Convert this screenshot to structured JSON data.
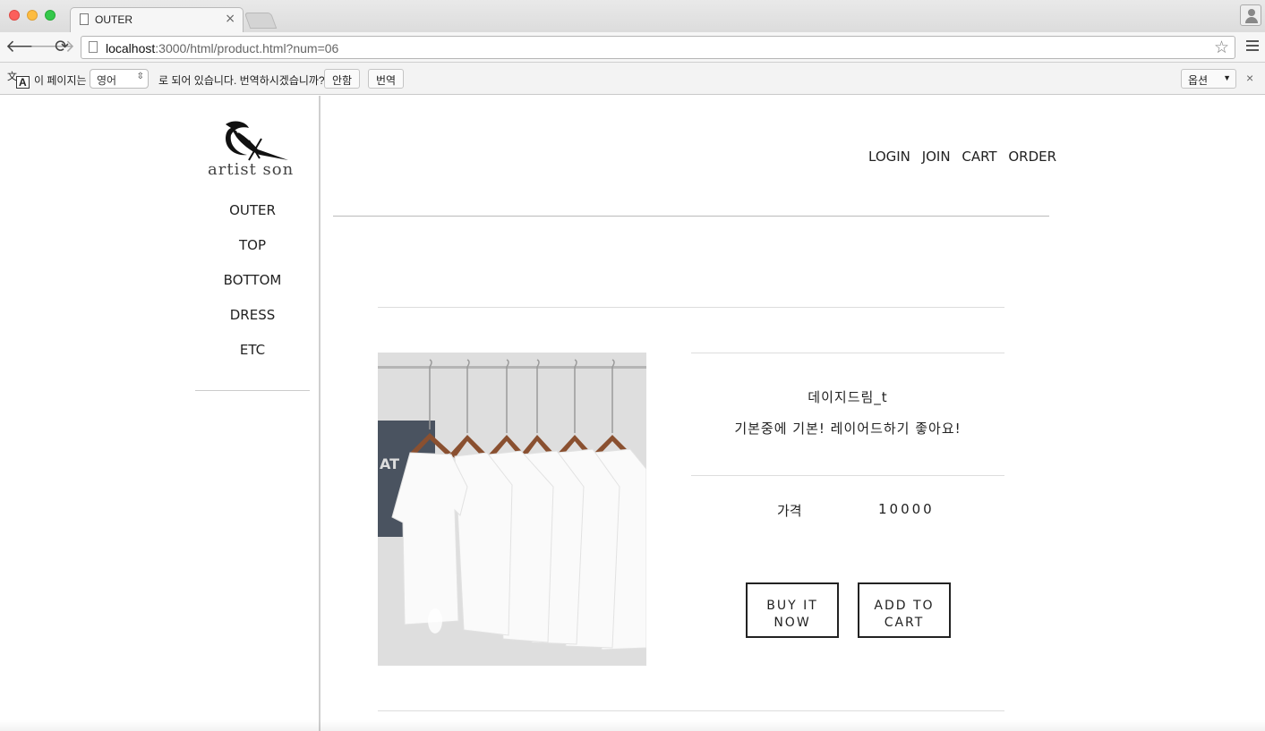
{
  "browser": {
    "tab_title": "OUTER",
    "tab_close": "×",
    "url_host": "localhost",
    "url_rest": ":3000/html/product.html?num=06"
  },
  "translate_bar": {
    "prefix": "이 페이지는",
    "language": "영어",
    "suffix": "로 되어 있습니다. 번역하시겠습니까?",
    "decline_label": "안함",
    "accept_label": "번역",
    "options_label": "옵션",
    "close": "×"
  },
  "brand": {
    "logo_text": "artist son"
  },
  "categories": [
    "OUTER",
    "TOP",
    "BOTTOM",
    "DRESS",
    "ETC"
  ],
  "top_menu": [
    "LOGIN",
    "JOIN",
    "CART",
    "ORDER"
  ],
  "product": {
    "name": "데이지드림_t",
    "description": "기본중에 기본! 레이어드하기 좋아요!",
    "price_label": "가격",
    "price": "10000",
    "buy_label_line1": "BUY IT",
    "buy_label_line2": "NOW",
    "cart_label_line1": "ADD TO",
    "cart_label_line2": "CART",
    "image": "white t-shirts on hangers photo"
  },
  "colors": {
    "border": "#222222",
    "divider": "#dddddd"
  }
}
